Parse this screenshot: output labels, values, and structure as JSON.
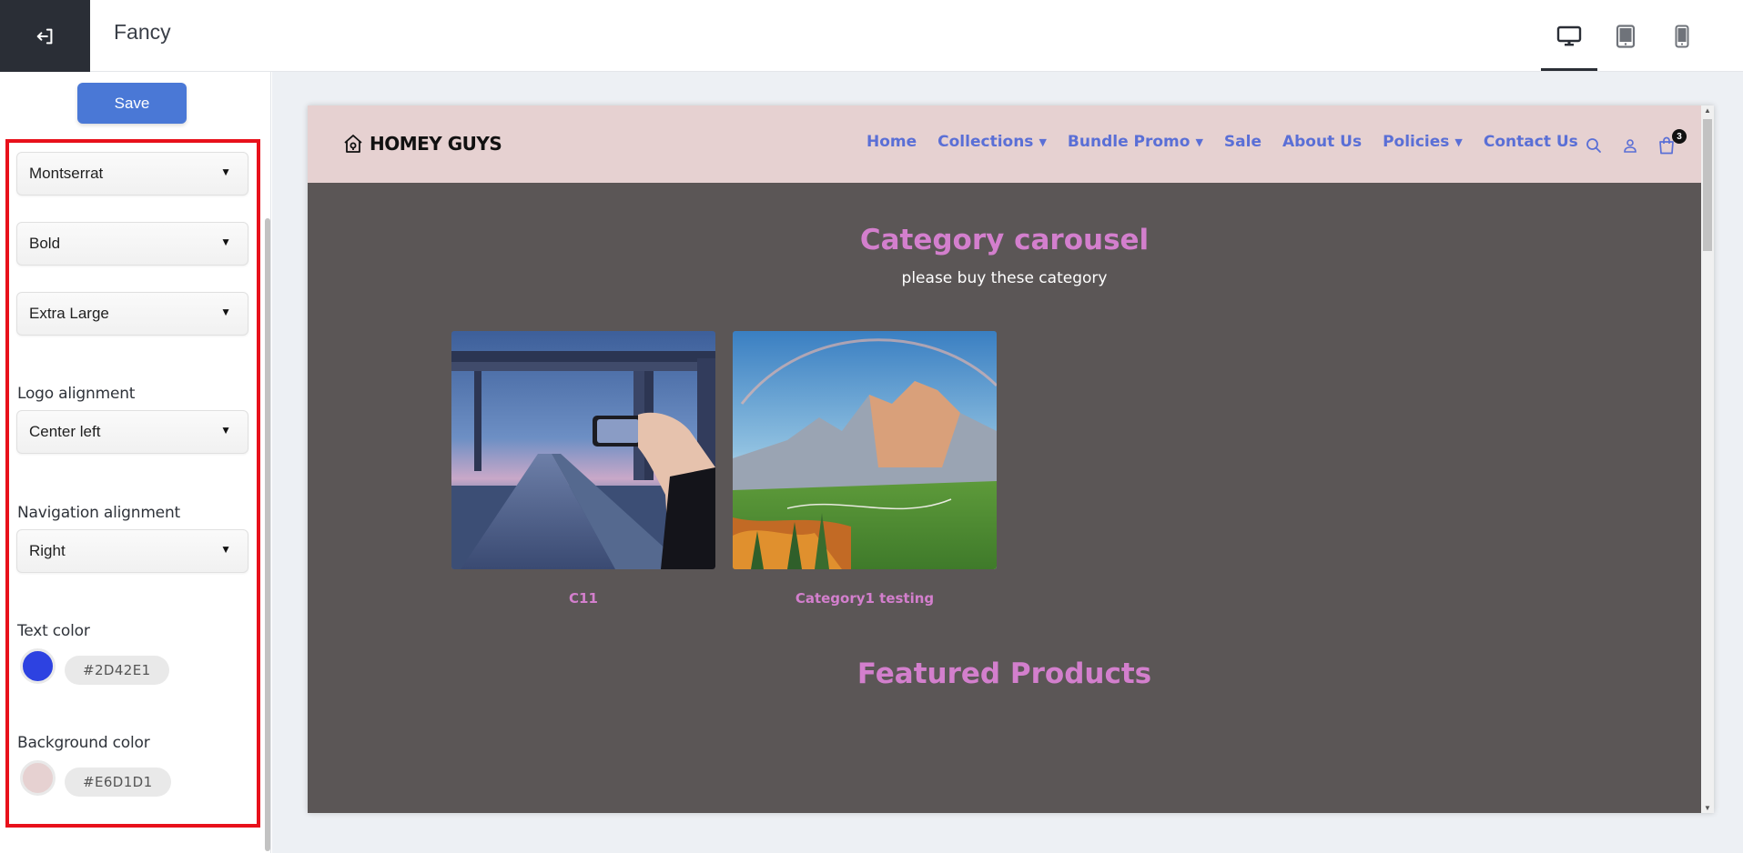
{
  "app": {
    "title": "Fancy"
  },
  "device_modes": [
    {
      "name": "desktop",
      "active": true
    },
    {
      "name": "tablet",
      "active": false
    },
    {
      "name": "mobile",
      "active": false
    }
  ],
  "sidebar": {
    "save_label": "Save",
    "font_family": "Montserrat",
    "font_weight": "Bold",
    "font_size": "Extra Large",
    "logo_alignment": {
      "label": "Logo alignment",
      "value": "Center left"
    },
    "navigation_alignment": {
      "label": "Navigation alignment",
      "value": "Right"
    },
    "text_color": {
      "label": "Text color",
      "value": "#2D42E1"
    },
    "background_color": {
      "label": "Background color",
      "value": "#E6D1D1"
    }
  },
  "preview": {
    "logo_text": "HOMEY GUYS",
    "nav": [
      {
        "label": "Home",
        "dropdown": false
      },
      {
        "label": "Collections",
        "dropdown": true
      },
      {
        "label": "Bundle Promo",
        "dropdown": true
      },
      {
        "label": "Sale",
        "dropdown": false
      },
      {
        "label": "About Us",
        "dropdown": false
      },
      {
        "label": "Policies",
        "dropdown": true
      },
      {
        "label": "Contact Us",
        "dropdown": false
      }
    ],
    "cart_count": "3",
    "carousel_title": "Category carousel",
    "carousel_subtitle": "please buy these category",
    "categories": [
      {
        "name": "C11",
        "image": "bridge-road-phone-photo"
      },
      {
        "name": "Category1 testing",
        "image": "mountain-valley-rainbow"
      }
    ],
    "featured_title": "Featured Products"
  },
  "colors": {
    "header_bg": "#E6D1D1",
    "nav_text": "#5a6fd6",
    "accent_pink": "#d37fcd",
    "preview_bg": "#5b5656",
    "save_blue": "#4a78d6",
    "highlight_red": "#e8111b"
  }
}
